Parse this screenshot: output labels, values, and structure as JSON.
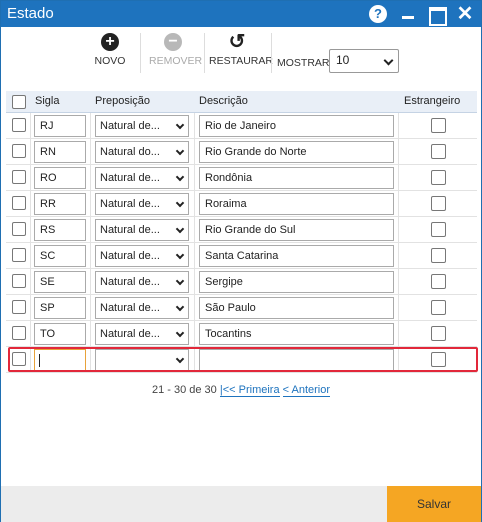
{
  "window": {
    "title": "Estado"
  },
  "toolbar": {
    "new_label": "NOVO",
    "remove_label": "REMOVER",
    "restore_label": "RESTAURAR",
    "show_label": "MOSTRAR:",
    "show_value": "10"
  },
  "table": {
    "headers": {
      "sigla": "Sigla",
      "preposicao": "Preposição",
      "descricao": "Descrição",
      "estrangeiro": "Estrangeiro"
    },
    "rows": [
      {
        "sigla": "RJ",
        "preposicao": "Natural de...",
        "descricao": "Rio de Janeiro"
      },
      {
        "sigla": "RN",
        "preposicao": "Natural do...",
        "descricao": "Rio Grande do Norte"
      },
      {
        "sigla": "RO",
        "preposicao": "Natural de...",
        "descricao": "Rondônia"
      },
      {
        "sigla": "RR",
        "preposicao": "Natural de...",
        "descricao": "Roraima"
      },
      {
        "sigla": "RS",
        "preposicao": "Natural de...",
        "descricao": "Rio Grande do Sul"
      },
      {
        "sigla": "SC",
        "preposicao": "Natural de...",
        "descricao": "Santa Catarina"
      },
      {
        "sigla": "SE",
        "preposicao": "Natural de...",
        "descricao": "Sergipe"
      },
      {
        "sigla": "SP",
        "preposicao": "Natural de...",
        "descricao": "São Paulo"
      },
      {
        "sigla": "TO",
        "preposicao": "Natural de...",
        "descricao": "Tocantins"
      }
    ],
    "new_row": {
      "sigla": "",
      "preposicao": "",
      "descricao": ""
    }
  },
  "pager": {
    "range": "21 - 30 de 30",
    "first": "|<< Primeira",
    "previous": "< Anterior"
  },
  "footer": {
    "save_label": "Salvar"
  },
  "colors": {
    "titlebar": "#1e73be",
    "save_button": "#f5a623",
    "highlight": "#e2283a"
  }
}
